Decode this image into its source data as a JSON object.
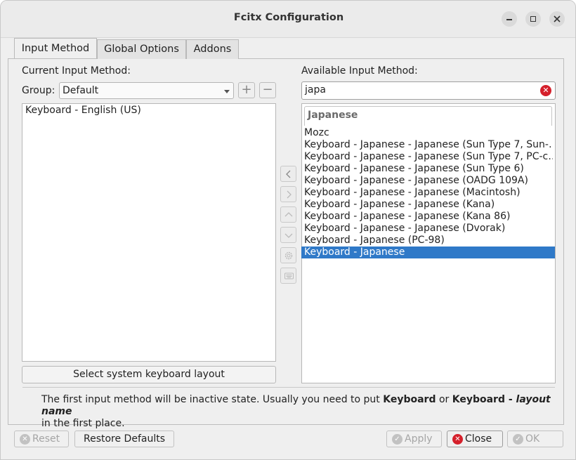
{
  "window": {
    "title": "Fcitx Configuration"
  },
  "tabs": [
    {
      "label": "Input Method",
      "active": true
    },
    {
      "label": "Global Options",
      "active": false
    },
    {
      "label": "Addons",
      "active": false
    }
  ],
  "current": {
    "heading": "Current Input Method:",
    "group_label": "Group:",
    "group_value": "Default",
    "items": [
      "Keyboard - English (US)"
    ],
    "select_layout_button": "Select system keyboard layout"
  },
  "available": {
    "heading": "Available Input Method:",
    "search_value": "japa",
    "group_header": "Japanese",
    "items": [
      "Mozc",
      "Keyboard - Japanese - Japanese (Sun Type 7, Sun-…",
      "Keyboard - Japanese - Japanese (Sun Type 7, PC-c…",
      "Keyboard - Japanese - Japanese (Sun Type 6)",
      "Keyboard - Japanese - Japanese (OADG 109A)",
      "Keyboard - Japanese - Japanese (Macintosh)",
      "Keyboard - Japanese - Japanese (Kana)",
      "Keyboard - Japanese - Japanese (Kana 86)",
      "Keyboard - Japanese - Japanese (Dvorak)",
      "Keyboard - Japanese (PC-98)",
      "Keyboard - Japanese"
    ],
    "selected_index": 10
  },
  "note": {
    "text1": "The first input method will be inactive state. Usually you need to put ",
    "bold1": "Keyboard",
    "text2": " or ",
    "bold2": "Keyboard - ",
    "bolditalic": "layout name",
    "text3": "in the first place."
  },
  "footer": {
    "reset": "Reset",
    "restore_defaults": "Restore Defaults",
    "apply": "Apply",
    "close": "Close",
    "ok": "OK"
  },
  "colors": {
    "selection": "#2f79c8",
    "close_icon": "#d5202b"
  }
}
